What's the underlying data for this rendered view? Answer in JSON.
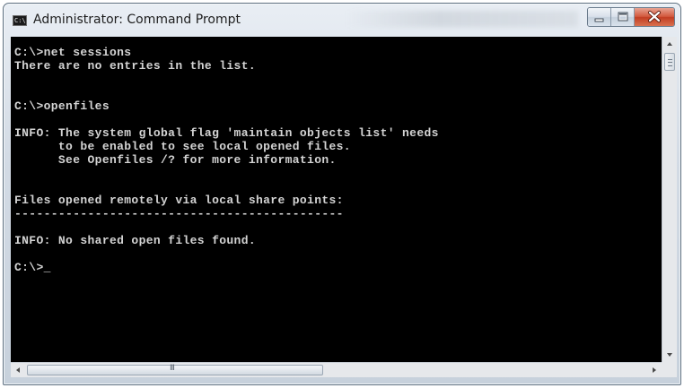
{
  "window": {
    "title": "Administrator: Command Prompt",
    "app_icon_text": "C:\\",
    "controls": {
      "minimize_icon": "minimize-icon",
      "maximize_icon": "maximize-icon",
      "close_icon": "close-icon"
    }
  },
  "console": {
    "lines": [
      "C:\\>net sessions",
      "There are no entries in the list.",
      "",
      "",
      "C:\\>openfiles",
      "",
      "INFO: The system global flag 'maintain objects list' needs",
      "      to be enabled to see local opened files.",
      "      See Openfiles /? for more information.",
      "",
      "",
      "Files opened remotely via local share points:",
      "---------------------------------------------",
      "",
      "INFO: No shared open files found.",
      "",
      "C:\\>_"
    ]
  },
  "scrollbars": {
    "horizontal_grip": "III",
    "colors": {
      "console_bg": "#000000",
      "console_fg": "#d4d4d4",
      "close_button": "#c8472c"
    }
  }
}
